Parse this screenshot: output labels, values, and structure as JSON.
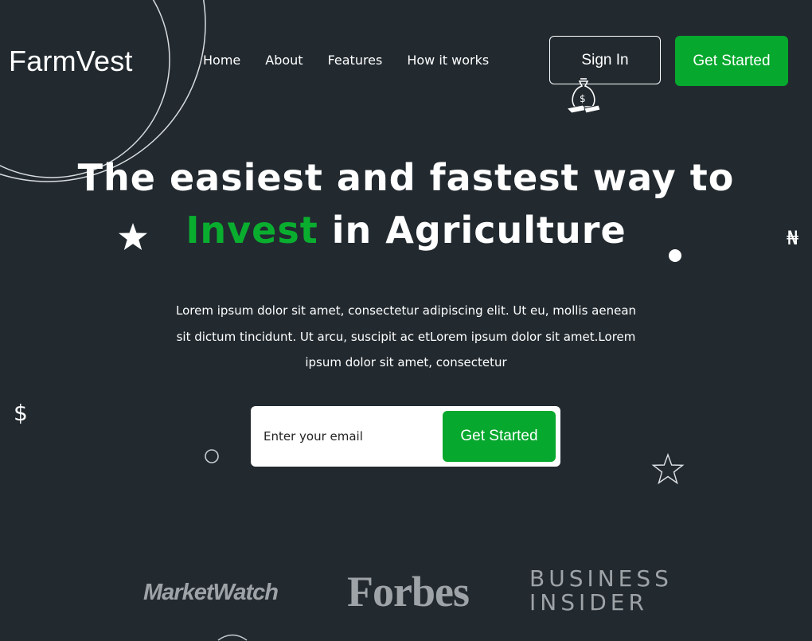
{
  "brand": {
    "name": "FarmVest"
  },
  "nav": {
    "items": [
      "Home",
      "About",
      "Features",
      "How it works"
    ]
  },
  "header": {
    "signin_label": "Sign In",
    "get_started_label": "Get Started"
  },
  "hero": {
    "title_line1": "The easiest and fastest way to",
    "title_highlight": "Invest",
    "title_line2_rest": " in Agriculture",
    "subtitle": "Lorem ipsum dolor sit amet, consectetur adipiscing elit. Ut eu, mollis aenean sit dictum tincidunt. Ut arcu, suscipit ac etLorem ipsum dolor sit amet.Lorem ipsum dolor sit amet, consectetur"
  },
  "signup": {
    "email_placeholder": "Enter your email",
    "button_label": "Get Started"
  },
  "press": {
    "logos": [
      "MarketWatch",
      "Forbes",
      "BUSINESS",
      "INSIDER"
    ]
  },
  "decorations": {
    "currency_symbols": [
      "₦",
      "$"
    ],
    "icons": [
      "money-bag-icon",
      "star-filled-icon",
      "star-outline-icon",
      "circle-dot-icon",
      "circle-outline-icon"
    ]
  },
  "colors": {
    "background": "#222a30",
    "accent": "#06a82d",
    "highlight_text": "#0aae2f",
    "press_logo": "#9ea3a7"
  }
}
